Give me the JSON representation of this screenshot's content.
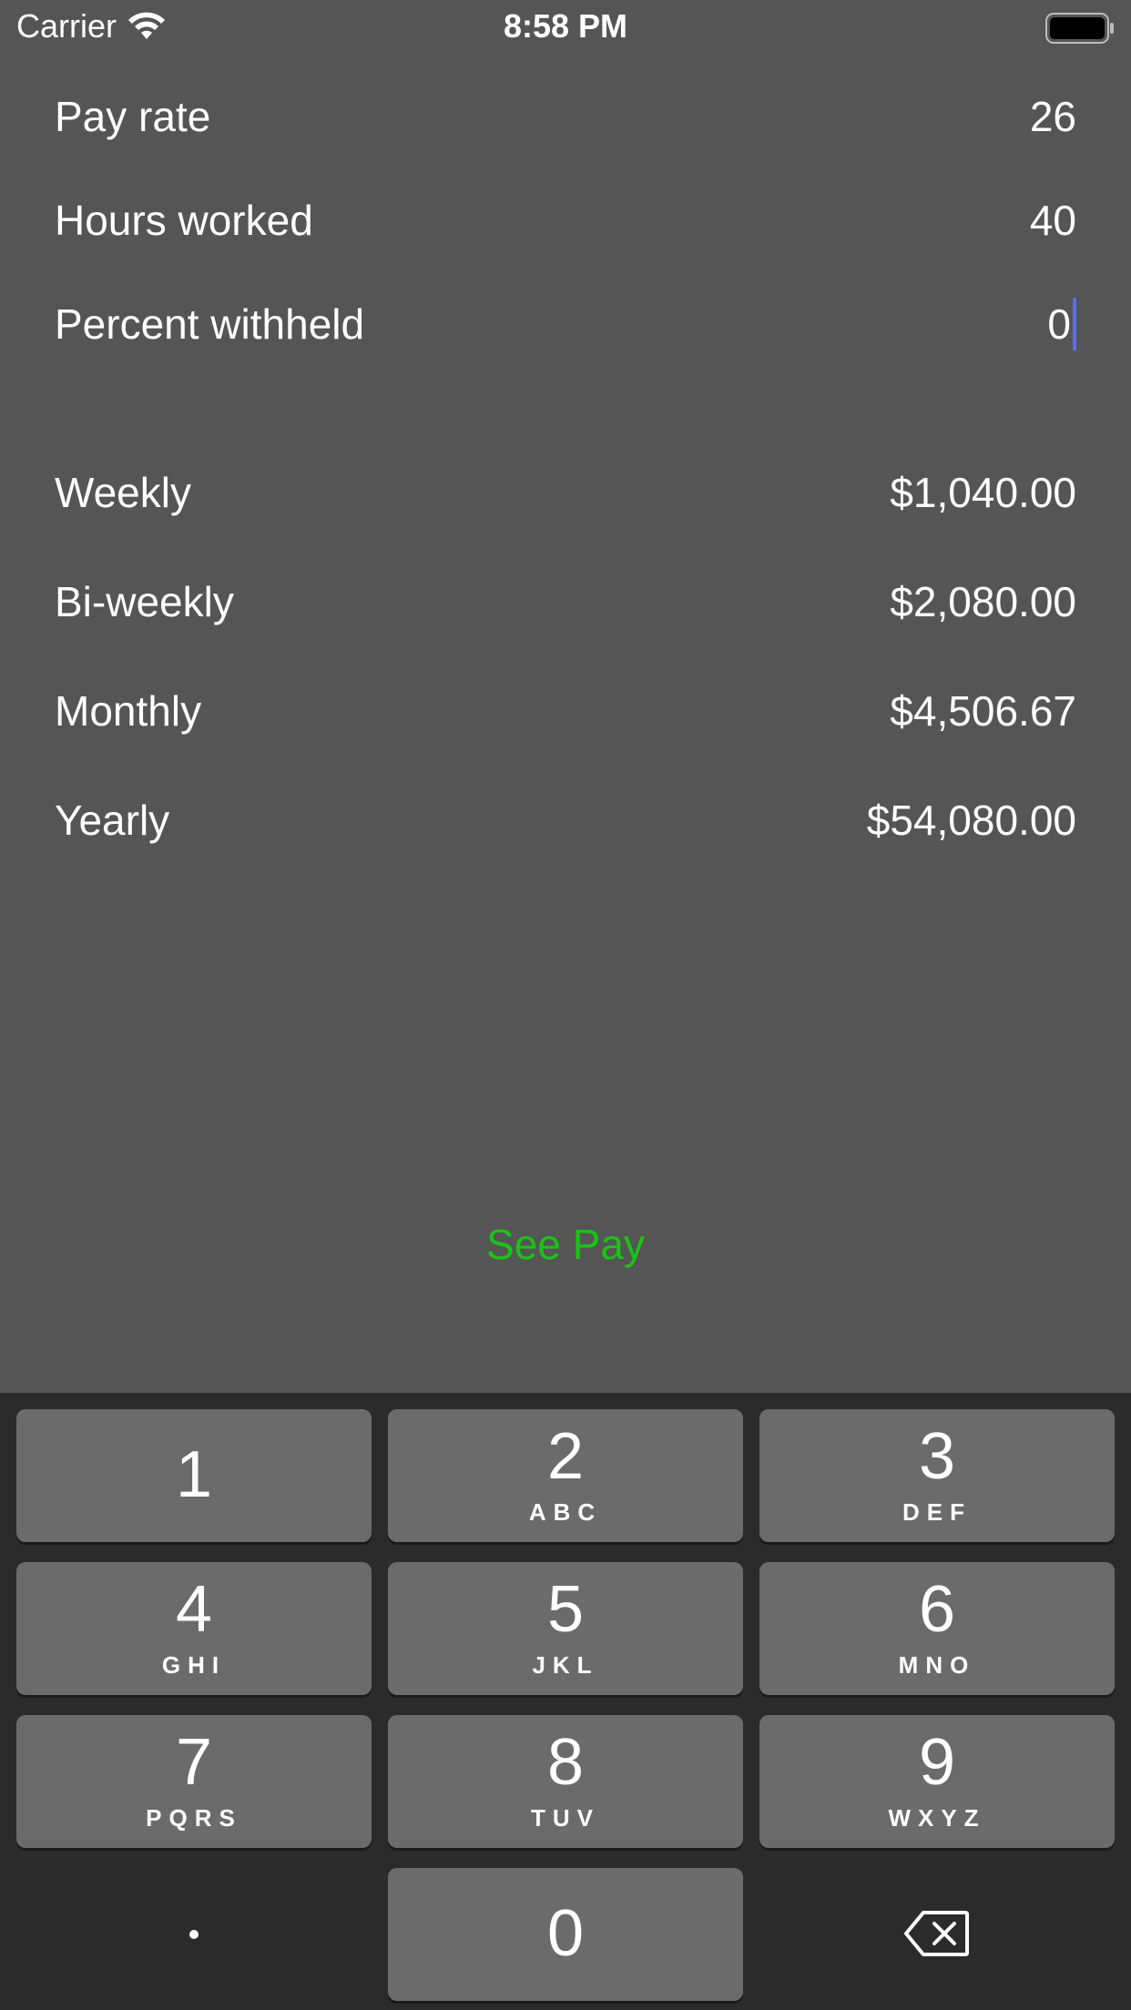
{
  "status_bar": {
    "carrier": "Carrier",
    "time": "8:58 PM",
    "wifi_icon": "wifi-icon",
    "battery_icon": "battery-icon"
  },
  "form": {
    "pay_rate": {
      "label": "Pay rate",
      "value": "26"
    },
    "hours_worked": {
      "label": "Hours worked",
      "value": "40"
    },
    "percent_withheld": {
      "label": "Percent withheld",
      "value": "0"
    }
  },
  "results": {
    "weekly": {
      "label": "Weekly",
      "value": "$1,040.00"
    },
    "biweekly": {
      "label": "Bi-weekly",
      "value": "$2,080.00"
    },
    "monthly": {
      "label": "Monthly",
      "value": "$4,506.67"
    },
    "yearly": {
      "label": "Yearly",
      "value": "$54,080.00"
    }
  },
  "actions": {
    "see_pay": "See Pay"
  },
  "keyboard": {
    "keys": [
      {
        "digit": "1",
        "letters": ""
      },
      {
        "digit": "2",
        "letters": "ABC"
      },
      {
        "digit": "3",
        "letters": "DEF"
      },
      {
        "digit": "4",
        "letters": "GHI"
      },
      {
        "digit": "5",
        "letters": "JKL"
      },
      {
        "digit": "6",
        "letters": "MNO"
      },
      {
        "digit": "7",
        "letters": "PQRS"
      },
      {
        "digit": "8",
        "letters": "TUV"
      },
      {
        "digit": "9",
        "letters": "WXYZ"
      },
      {
        "digit": "0",
        "letters": ""
      }
    ],
    "decimal_key": ".",
    "delete_icon": "backspace-icon"
  },
  "colors": {
    "background": "#555555",
    "keyboard_background": "#2b2b2b",
    "key_background": "#6b6b6b",
    "see_pay": "#19c414",
    "caret": "#5a6cf0"
  }
}
